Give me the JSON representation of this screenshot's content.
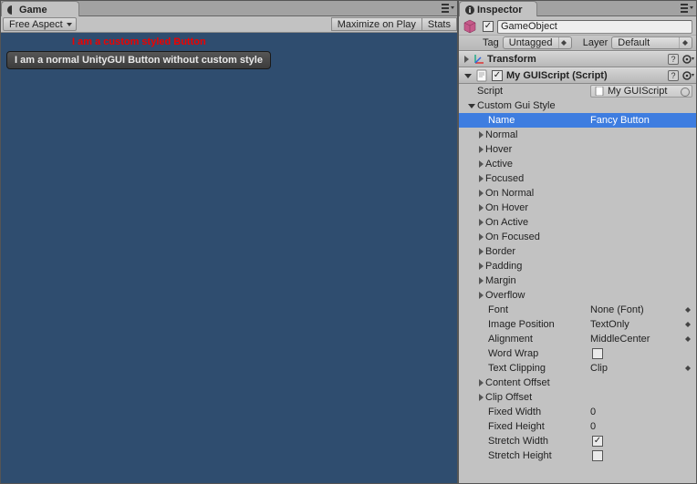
{
  "game": {
    "tab_label": "Game",
    "aspect": "Free Aspect",
    "maximize": "Maximize on Play",
    "stats": "Stats",
    "fancy_button_text": "I am a custom styled Button",
    "normal_button_text": "I am a normal UnityGUI Button without custom style"
  },
  "inspector": {
    "tab_label": "Inspector",
    "object_name": "GameObject",
    "tag_label": "Tag",
    "tag_value": "Untagged",
    "layer_label": "Layer",
    "layer_value": "Default",
    "transform_title": "Transform",
    "script_component_title": "My GUIScript (Script)",
    "script_label": "Script",
    "script_value": "My GUIScript",
    "custom_style_label": "Custom Gui Style",
    "name_label": "Name",
    "name_value": "Fancy Button",
    "states": [
      "Normal",
      "Hover",
      "Active",
      "Focused",
      "On Normal",
      "On Hover",
      "On Active",
      "On Focused",
      "Border",
      "Padding",
      "Margin",
      "Overflow"
    ],
    "font_label": "Font",
    "font_value": "None (Font)",
    "image_position_label": "Image Position",
    "image_position_value": "TextOnly",
    "alignment_label": "Alignment",
    "alignment_value": "MiddleCenter",
    "word_wrap_label": "Word Wrap",
    "text_clipping_label": "Text Clipping",
    "text_clipping_value": "Clip",
    "content_offset_label": "Content Offset",
    "clip_offset_label": "Clip Offset",
    "fixed_width_label": "Fixed Width",
    "fixed_width_value": "0",
    "fixed_height_label": "Fixed Height",
    "fixed_height_value": "0",
    "stretch_width_label": "Stretch Width",
    "stretch_height_label": "Stretch Height"
  }
}
